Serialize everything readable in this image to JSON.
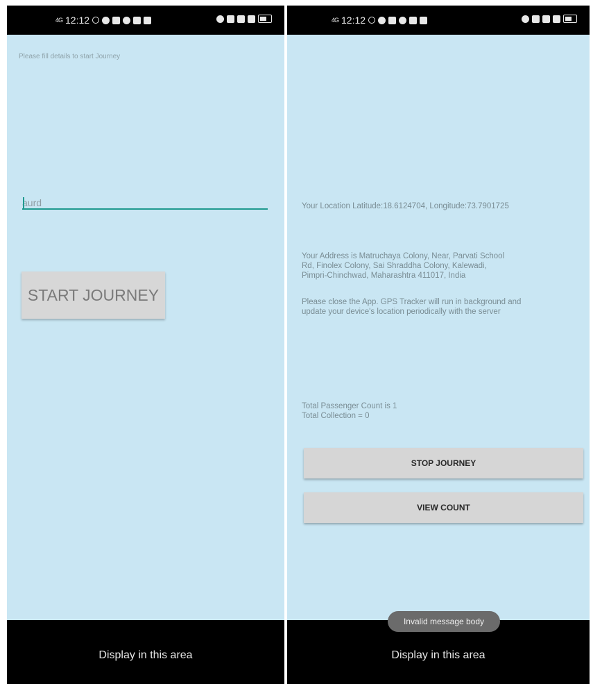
{
  "left_screen": {
    "status_bar": {
      "signal": "4G",
      "time": "12:12"
    },
    "hint": "Please fill details to start Journey",
    "input_value": "aurd",
    "start_button": "START JOURNEY",
    "nav_text": "Display in this area"
  },
  "right_screen": {
    "status_bar": {
      "signal": "4G",
      "time": "12:12"
    },
    "location_text": "Your Location Latitude:18.6124704, Longitude:73.7901725",
    "address_lines": [
      "Your Address is Matruchaya Colony, Near, Parvati School",
      "Rd, Finolex Colony, Sai Shraddha Colony, Kalewadi,",
      "Pimpri-Chinchwad, Maharashtra 411017, India"
    ],
    "notice_lines": [
      "Please close the App. GPS Tracker will run in background and",
      "update your device's location periodically with the server"
    ],
    "passenger_count": "Total Passenger Count is 1",
    "collection": "Total Collection = 0",
    "stop_button": "STOP JOURNEY",
    "view_button": "VIEW COUNT",
    "toast": "Invalid message body",
    "nav_text": "Display in this area"
  },
  "colors": {
    "background": "#c9e6f3",
    "bars": "#000000",
    "accent": "#1f9a8f",
    "button": "#d6d6d6"
  }
}
